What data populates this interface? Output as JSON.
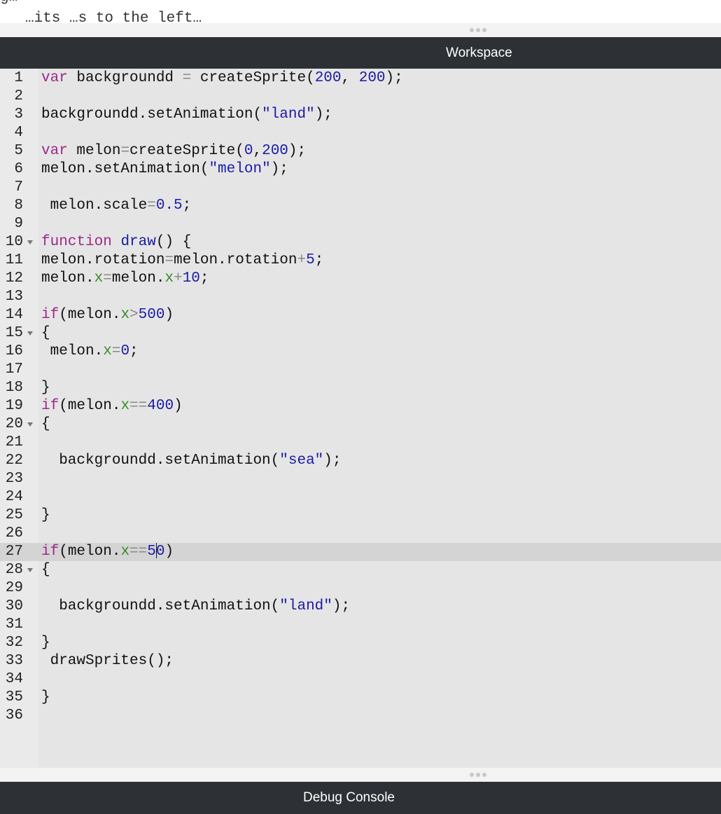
{
  "page_top_text": {
    "line1": "g…",
    "line2": "…its …s to the left…"
  },
  "workspace": {
    "title": "Workspace"
  },
  "debug_console": {
    "title": "Debug Console"
  },
  "editor": {
    "active_line": 27,
    "folded_lines": [
      10,
      15,
      20,
      28
    ],
    "lines": [
      [
        [
          "kw",
          "var"
        ],
        [
          "plain",
          " backgroundd "
        ],
        [
          "op",
          "="
        ],
        [
          "plain",
          " createSprite("
        ],
        [
          "num",
          "200"
        ],
        [
          "plain",
          ", "
        ],
        [
          "num",
          "200"
        ],
        [
          "plain",
          ");"
        ]
      ],
      [],
      [
        [
          "plain",
          "backgroundd.setAnimation("
        ],
        [
          "str",
          "\"land\""
        ],
        [
          "plain",
          ");"
        ]
      ],
      [],
      [
        [
          "kw",
          "var"
        ],
        [
          "plain",
          " melon"
        ],
        [
          "op",
          "="
        ],
        [
          "plain",
          "createSprite("
        ],
        [
          "num",
          "0"
        ],
        [
          "plain",
          ","
        ],
        [
          "num",
          "200"
        ],
        [
          "plain",
          ");"
        ]
      ],
      [
        [
          "plain",
          "melon.setAnimation("
        ],
        [
          "str",
          "\"melon\""
        ],
        [
          "plain",
          ");"
        ]
      ],
      [],
      [
        [
          "plain",
          " melon.scale"
        ],
        [
          "op",
          "="
        ],
        [
          "num",
          "0.5"
        ],
        [
          "plain",
          ";"
        ]
      ],
      [],
      [
        [
          "kw",
          "function"
        ],
        [
          "plain",
          " "
        ],
        [
          "def",
          "draw"
        ],
        [
          "plain",
          "() {"
        ]
      ],
      [
        [
          "plain",
          "melon.rotation"
        ],
        [
          "op",
          "="
        ],
        [
          "plain",
          "melon.rotation"
        ],
        [
          "op",
          "+"
        ],
        [
          "num",
          "5"
        ],
        [
          "plain",
          ";"
        ]
      ],
      [
        [
          "plain",
          "melon."
        ],
        [
          "prop",
          "x"
        ],
        [
          "op",
          "="
        ],
        [
          "plain",
          "melon."
        ],
        [
          "prop",
          "x"
        ],
        [
          "op",
          "+"
        ],
        [
          "num",
          "10"
        ],
        [
          "plain",
          ";"
        ]
      ],
      [],
      [
        [
          "kw",
          "if"
        ],
        [
          "plain",
          "(melon."
        ],
        [
          "prop",
          "x"
        ],
        [
          "op",
          ">"
        ],
        [
          "num",
          "500"
        ],
        [
          "plain",
          ")"
        ]
      ],
      [
        [
          "plain",
          "{"
        ]
      ],
      [
        [
          "plain",
          " melon."
        ],
        [
          "prop",
          "x"
        ],
        [
          "op",
          "="
        ],
        [
          "num",
          "0"
        ],
        [
          "plain",
          ";"
        ]
      ],
      [],
      [
        [
          "plain",
          "}"
        ]
      ],
      [
        [
          "kw",
          "if"
        ],
        [
          "plain",
          "(melon."
        ],
        [
          "prop",
          "x"
        ],
        [
          "op",
          "=="
        ],
        [
          "num",
          "400"
        ],
        [
          "plain",
          ")"
        ]
      ],
      [
        [
          "plain",
          "{"
        ]
      ],
      [],
      [
        [
          "plain",
          "  backgroundd.setAnimation("
        ],
        [
          "str",
          "\"sea\""
        ],
        [
          "plain",
          ");"
        ]
      ],
      [],
      [],
      [
        [
          "plain",
          "}"
        ]
      ],
      [],
      [
        [
          "kw",
          "if"
        ],
        [
          "plain",
          "(melon."
        ],
        [
          "prop",
          "x"
        ],
        [
          "op",
          "=="
        ],
        [
          "num",
          "5"
        ],
        [
          "cursor",
          ""
        ],
        [
          "num",
          "0"
        ],
        [
          "plain",
          ")"
        ]
      ],
      [
        [
          "plain",
          "{"
        ]
      ],
      [],
      [
        [
          "plain",
          "  backgroundd.setAnimation("
        ],
        [
          "str",
          "\"land\""
        ],
        [
          "plain",
          ");"
        ]
      ],
      [],
      [
        [
          "plain",
          "}"
        ]
      ],
      [
        [
          "plain",
          " drawSprites();"
        ]
      ],
      [],
      [
        [
          "plain",
          "}"
        ]
      ],
      []
    ]
  }
}
